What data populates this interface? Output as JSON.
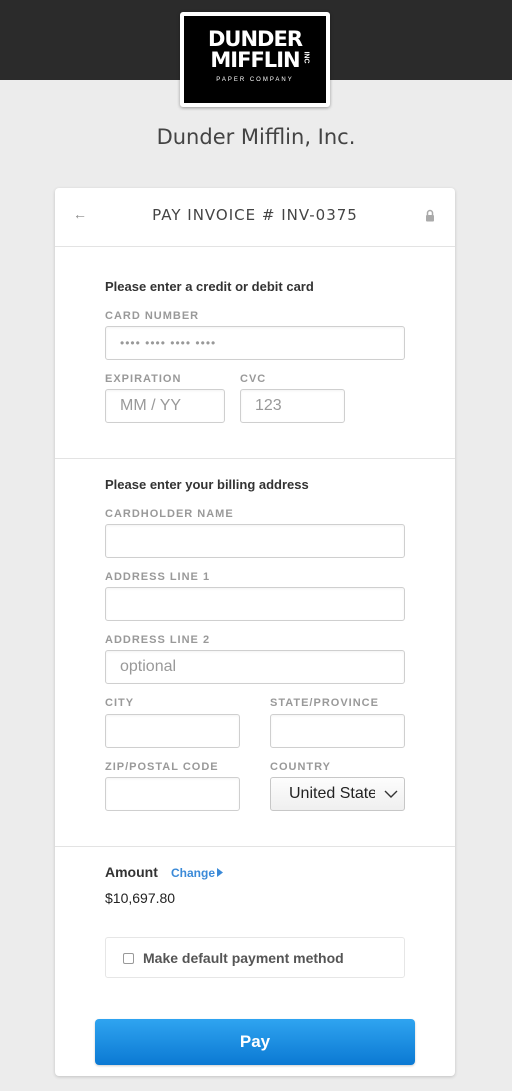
{
  "brand": {
    "logo_line1": "DUNDER",
    "logo_line2": "MIFFLIN",
    "logo_inc": "INC",
    "logo_subtitle": "PAPER COMPANY",
    "company_name": "Dunder Mifflin, Inc."
  },
  "header": {
    "title": "PAY INVOICE # INV-0375",
    "back_icon": "back-arrow-icon",
    "lock_icon": "lock-icon"
  },
  "card_section": {
    "title": "Please enter a credit or debit card",
    "card_number_label": "CARD NUMBER",
    "card_number_placeholder": "•••• •••• •••• ••••",
    "expiration_label": "EXPIRATION",
    "expiration_placeholder": "MM / YY",
    "cvc_label": "CVC",
    "cvc_placeholder": "123"
  },
  "billing_section": {
    "title": "Please enter your billing address",
    "cardholder_label": "CARDHOLDER NAME",
    "cardholder_value": "",
    "address1_label": "ADDRESS LINE 1",
    "address1_value": "",
    "address2_label": "ADDRESS LINE 2",
    "address2_placeholder": "optional",
    "city_label": "CITY",
    "city_value": "",
    "state_label": "STATE/PROVINCE",
    "state_value": "",
    "zip_label": "ZIP/POSTAL CODE",
    "zip_value": "",
    "country_label": "COUNTRY",
    "country_value": "United States"
  },
  "payment": {
    "amount_label": "Amount",
    "change_label": "Change",
    "amount_value": "$10,697.80",
    "default_label": "Make default payment method",
    "default_checked": false,
    "pay_label": "Pay"
  },
  "colors": {
    "topbar": "#2b2b2b",
    "accent": "#3b8ad8",
    "pay_button": "#1a8fe3"
  }
}
